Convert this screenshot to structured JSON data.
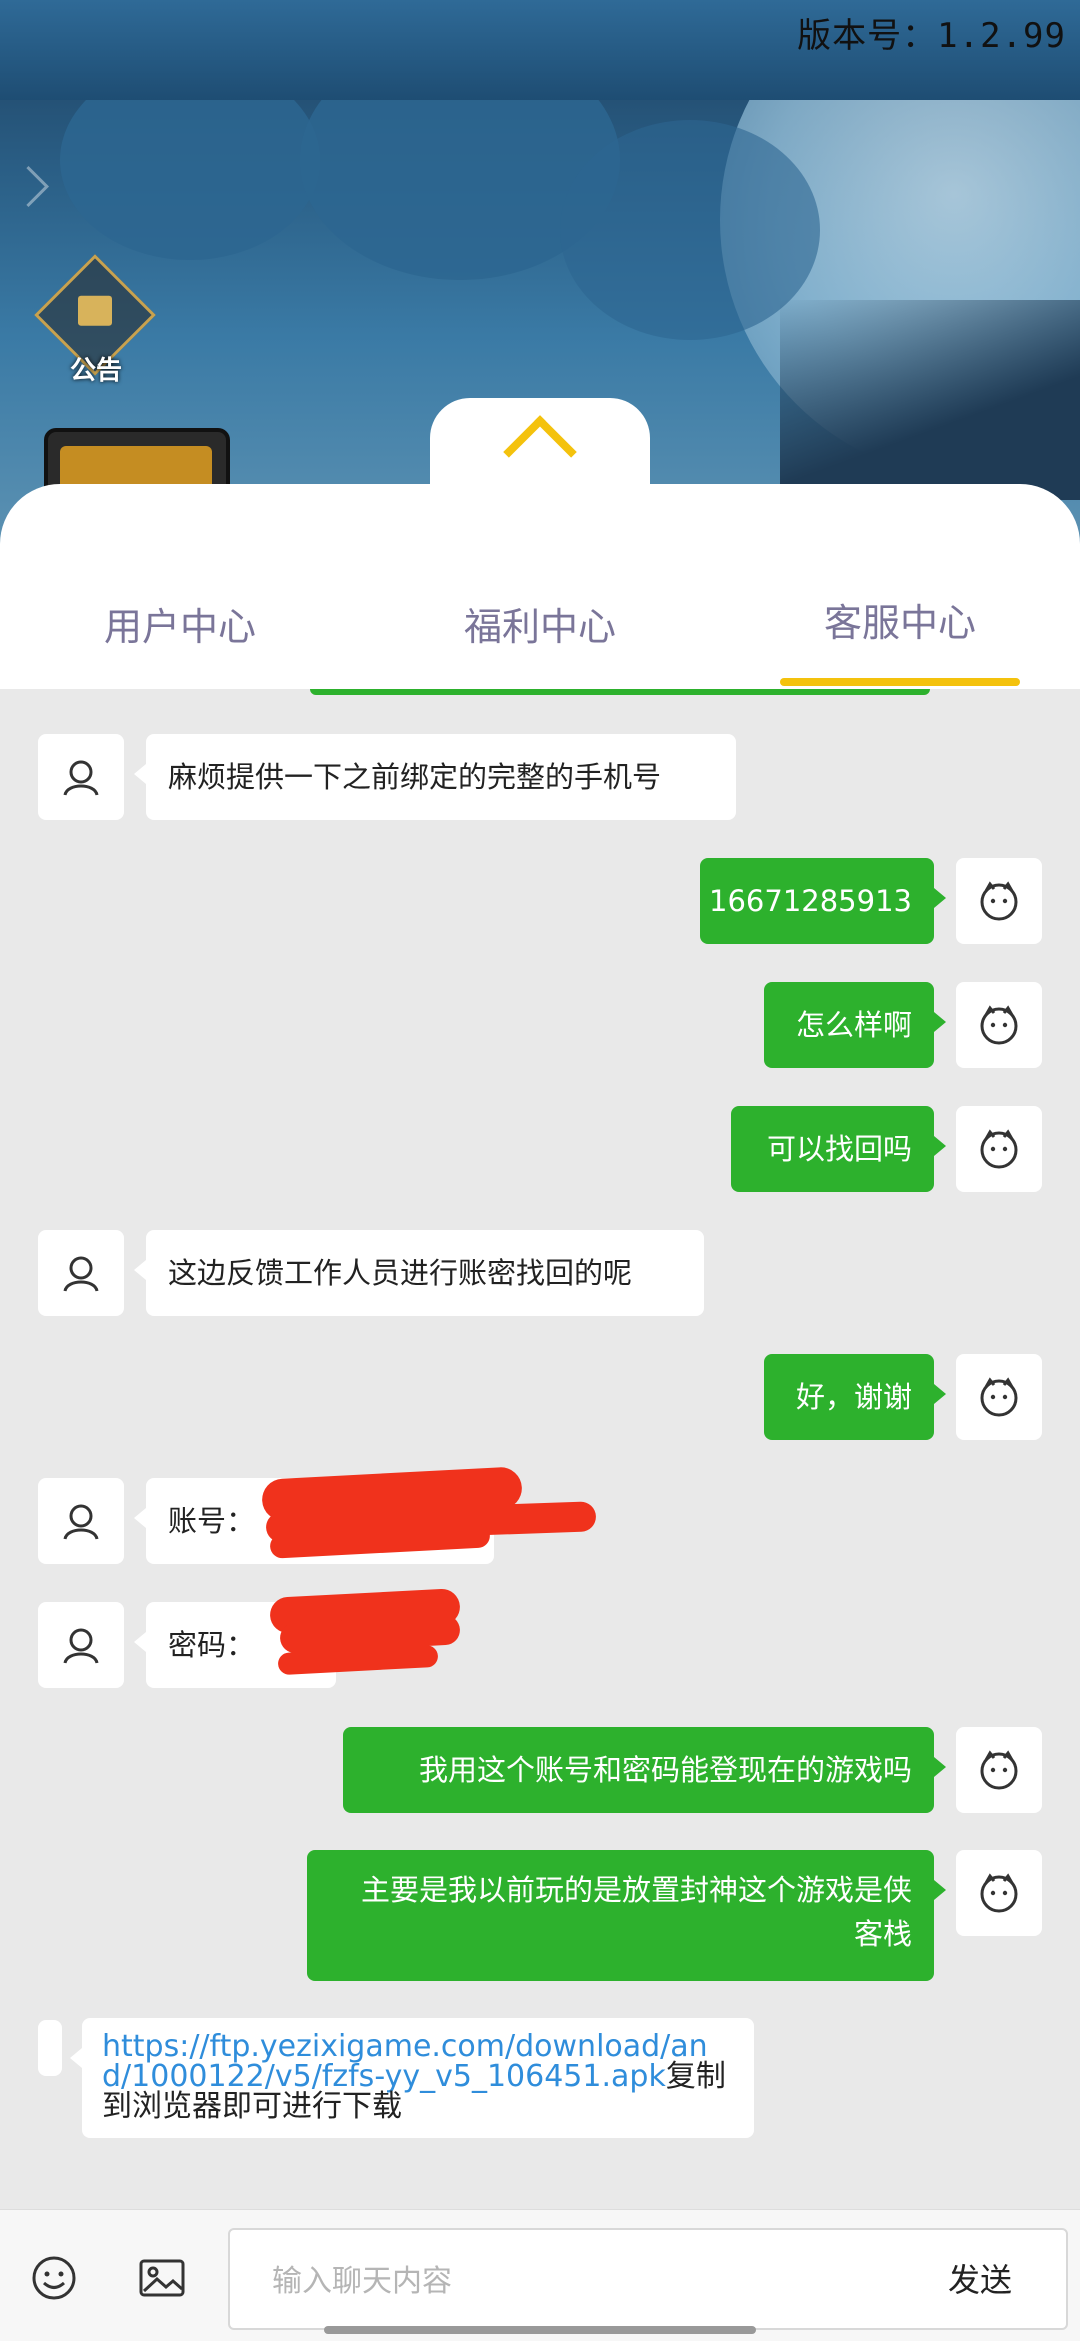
{
  "header": {
    "version": "版本号：1.2.99",
    "notice_label": "公告"
  },
  "tabs": [
    {
      "label": "用户中心",
      "active": false
    },
    {
      "label": "福利中心",
      "active": false
    },
    {
      "label": "客服中心",
      "active": true
    }
  ],
  "messages": [
    {
      "side": "left",
      "text": "麻烦提供一下之前绑定的完整的手机号"
    },
    {
      "side": "right",
      "text": "16671285913"
    },
    {
      "side": "right",
      "text": "怎么样啊"
    },
    {
      "side": "right",
      "text": "可以找回吗"
    },
    {
      "side": "left",
      "text": "这边反馈工作人员进行账密找回的呢"
    },
    {
      "side": "right",
      "text": "好，谢谢"
    },
    {
      "side": "left",
      "text": "账号：",
      "redacted": true
    },
    {
      "side": "left",
      "text": "密码：",
      "redacted": true
    },
    {
      "side": "right",
      "text": "我用这个账号和密码能登现在的游戏吗"
    },
    {
      "side": "right",
      "text": "主要是我以前玩的是放置封神这个游戏是侠客栈"
    },
    {
      "side": "left",
      "link": "https://ftp.yezixigame.com/download/and/1000122/v5/fzfs-yy_v5_106451.apk",
      "text": "复制到浏览器即可进行下载"
    }
  ],
  "input": {
    "placeholder": "输入聊天内容",
    "value": "",
    "send_label": "发送"
  },
  "colors": {
    "accent": "#f4c20d",
    "bubble_right": "#2db12d",
    "tab_text": "#7a7599",
    "link": "#2f8ddb"
  }
}
